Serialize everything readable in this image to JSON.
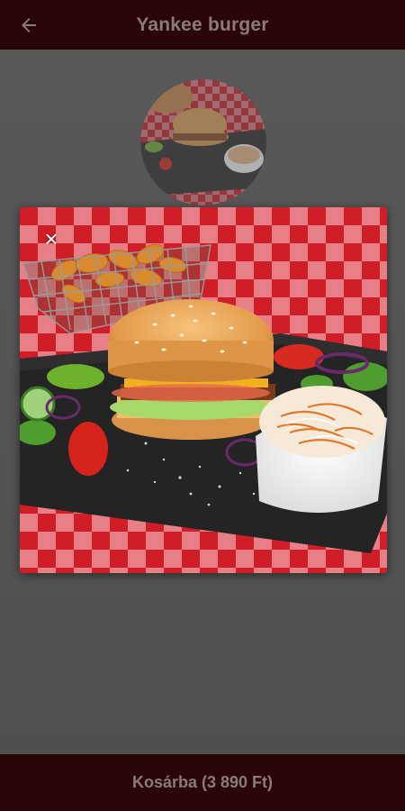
{
  "header": {
    "title": "Yankee burger",
    "back_icon": "arrow-left-icon"
  },
  "viewer": {
    "close_icon": "close-icon",
    "close_glyph": "×"
  },
  "footer": {
    "cart_label": "Kosárba (3 890 Ft)"
  },
  "colors": {
    "bar_background": "#2a0508",
    "bar_text": "#8a7a7c",
    "overlay": "#5a5a5a",
    "tablecloth_red": "#c8202a"
  }
}
